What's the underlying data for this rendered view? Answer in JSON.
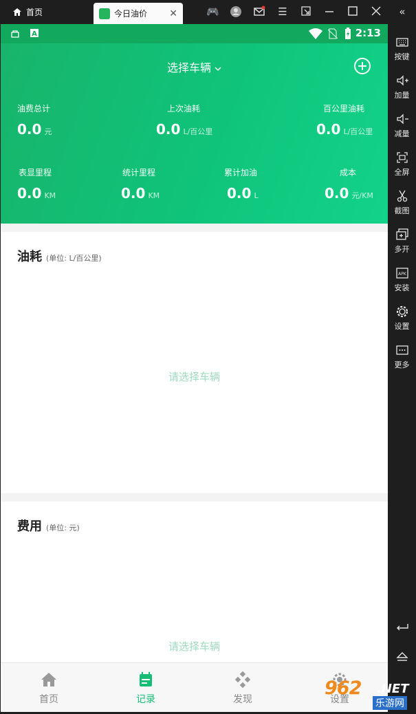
{
  "window": {
    "home_tab_label": "首页",
    "app_tab_label": "今日油价",
    "home_icon": "home-icon",
    "tab_close_icon": "close-icon"
  },
  "statusbar": {
    "time": "2:13"
  },
  "sidebar": {
    "items": [
      {
        "label": "按键",
        "icon": "keyboard-icon"
      },
      {
        "label": "加量",
        "icon": "volume-up-icon"
      },
      {
        "label": "减量",
        "icon": "volume-down-icon"
      },
      {
        "label": "全屏",
        "icon": "fullscreen-icon"
      },
      {
        "label": "截图",
        "icon": "scissors-icon"
      },
      {
        "label": "多开",
        "icon": "multi-instance-icon"
      },
      {
        "label": "安装",
        "icon": "apk-icon"
      },
      {
        "label": "设置",
        "icon": "gear-icon"
      },
      {
        "label": "更多",
        "icon": "more-icon"
      }
    ]
  },
  "header": {
    "vehicle_selector": "选择车辆",
    "stats_row1": [
      {
        "label": "油费总计",
        "value": "0.0",
        "unit": "元"
      },
      {
        "label": "上次油耗",
        "value": "0.0",
        "unit": "L/百公里"
      },
      {
        "label": "百公里油耗",
        "value": "0.0",
        "unit": "L/百公里"
      }
    ],
    "stats_row2": [
      {
        "label": "表显里程",
        "value": "0.0",
        "unit": "KM"
      },
      {
        "label": "统计里程",
        "value": "0.0",
        "unit": "KM"
      },
      {
        "label": "累计加油",
        "value": "0.0",
        "unit": "L"
      },
      {
        "label": "成本",
        "value": "0.0",
        "unit": "元/KM"
      }
    ]
  },
  "fuel_card": {
    "title": "油耗",
    "subtitle": "(单位: L/百公里)",
    "empty_text": "请选择车辆"
  },
  "cost_card": {
    "title": "费用",
    "subtitle": "(单位: 元)",
    "empty_text": "请选择车辆"
  },
  "tabbar": {
    "tabs": [
      {
        "label": "首页",
        "icon": "home-icon",
        "active": false
      },
      {
        "label": "记录",
        "icon": "calendar-icon",
        "active": true
      },
      {
        "label": "发现",
        "icon": "discover-icon",
        "active": false
      },
      {
        "label": "设置",
        "icon": "gear-icon",
        "active": false
      }
    ]
  },
  "watermark": {
    "number": "962",
    "domain": ".NET",
    "site_name": "乐游网"
  },
  "colors": {
    "accent": "#17bd75",
    "header_gradient_start": "#18b46b",
    "header_gradient_end": "#13d28a",
    "empty_text": "#9fd9bf"
  }
}
